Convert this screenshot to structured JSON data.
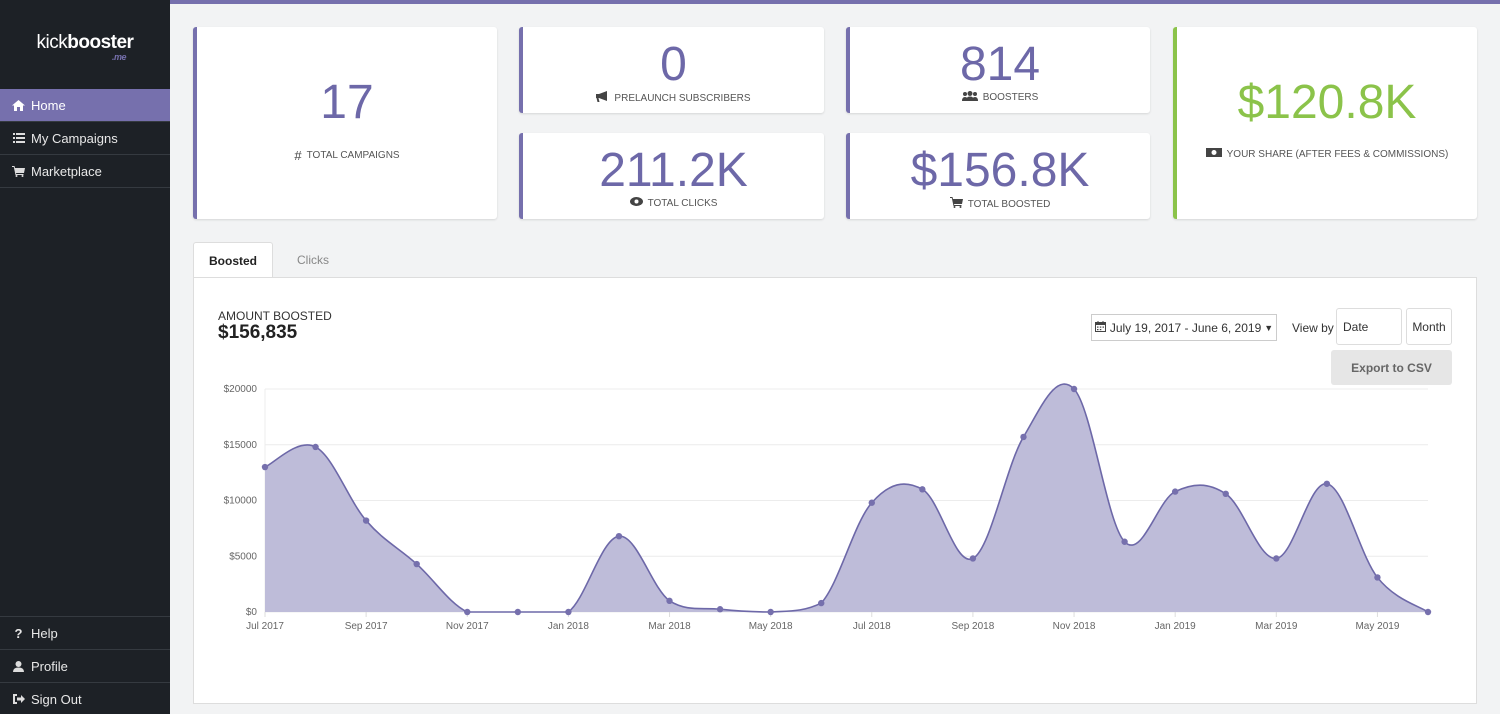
{
  "brand": {
    "name_light": "kick",
    "name_bold": "booster",
    "suffix": ".me"
  },
  "colors": {
    "accent": "#7670ad",
    "green": "#8bc34a",
    "sidebar": "#1d2126",
    "area_fill": "#bebcd9",
    "line": "#6d68a8"
  },
  "sidebar": {
    "items": [
      {
        "label": "Home",
        "icon": "home-icon",
        "active": true
      },
      {
        "label": "My Campaigns",
        "icon": "list-icon",
        "active": false
      },
      {
        "label": "Marketplace",
        "icon": "cart-icon",
        "active": false
      }
    ],
    "bottom_items": [
      {
        "label": "Help",
        "icon": "question-icon"
      },
      {
        "label": "Profile",
        "icon": "user-icon"
      },
      {
        "label": "Sign Out",
        "icon": "sign-out-icon"
      }
    ]
  },
  "stats": {
    "total_campaigns": {
      "value": "17",
      "label": "TOTAL CAMPAIGNS",
      "icon": "hash-icon"
    },
    "prelaunch_subscribers": {
      "value": "0",
      "label": "PRELAUNCH SUBSCRIBERS",
      "icon": "megaphone-icon"
    },
    "boosters": {
      "value": "814",
      "label": "BOOSTERS",
      "icon": "users-icon"
    },
    "total_clicks": {
      "value": "211.2K",
      "label": "TOTAL CLICKS",
      "icon": "eye-icon"
    },
    "total_boosted": {
      "value": "$156.8K",
      "label": "TOTAL BOOSTED",
      "icon": "cart-icon"
    },
    "your_share": {
      "value": "$120.8K",
      "label": "YOUR SHARE (AFTER FEES & COMMISSIONS)",
      "icon": "money-icon"
    }
  },
  "tabs": [
    {
      "label": "Boosted",
      "active": true
    },
    {
      "label": "Clicks",
      "active": false
    }
  ],
  "panel": {
    "amount_label": "AMOUNT BOOSTED",
    "amount_value": "$156,835",
    "date_range": "July 19, 2017 - June 6, 2019",
    "view_by_label": "View by",
    "view_by_date": "Date",
    "view_by_month": "Month",
    "export_label": "Export to CSV"
  },
  "chart_data": {
    "type": "area",
    "title": "",
    "xlabel": "",
    "ylabel": "",
    "x": [
      "Jul 2017",
      "Aug 2017",
      "Sep 2017",
      "Oct 2017",
      "Nov 2017",
      "Dec 2017",
      "Jan 2018",
      "Feb 2018",
      "Mar 2018",
      "Apr 2018",
      "May 2018",
      "Jun 2018",
      "Jul 2018",
      "Aug 2018",
      "Sep 2018",
      "Oct 2018",
      "Nov 2018",
      "Dec 2018",
      "Jan 2019",
      "Feb 2019",
      "Mar 2019",
      "Apr 2019",
      "May 2019",
      "Jun 2019"
    ],
    "values": [
      13000,
      14800,
      8200,
      4300,
      0,
      0,
      0,
      6800,
      1000,
      250,
      0,
      800,
      9800,
      11000,
      4800,
      15700,
      20000,
      6300,
      10800,
      10600,
      4800,
      11500,
      3100,
      0
    ],
    "x_tick_labels": [
      "Jul 2017",
      "Sep 2017",
      "Nov 2017",
      "Jan 2018",
      "Mar 2018",
      "May 2018",
      "Jul 2018",
      "Sep 2018",
      "Nov 2018",
      "Jan 2019",
      "Mar 2019",
      "May 2019"
    ],
    "y_tick_labels": [
      "$0",
      "$5000",
      "$10000",
      "$15000",
      "$20000"
    ],
    "y_ticks": [
      0,
      5000,
      10000,
      15000,
      20000
    ],
    "ylim": [
      0,
      20000
    ],
    "grid": true,
    "legend": "none"
  }
}
